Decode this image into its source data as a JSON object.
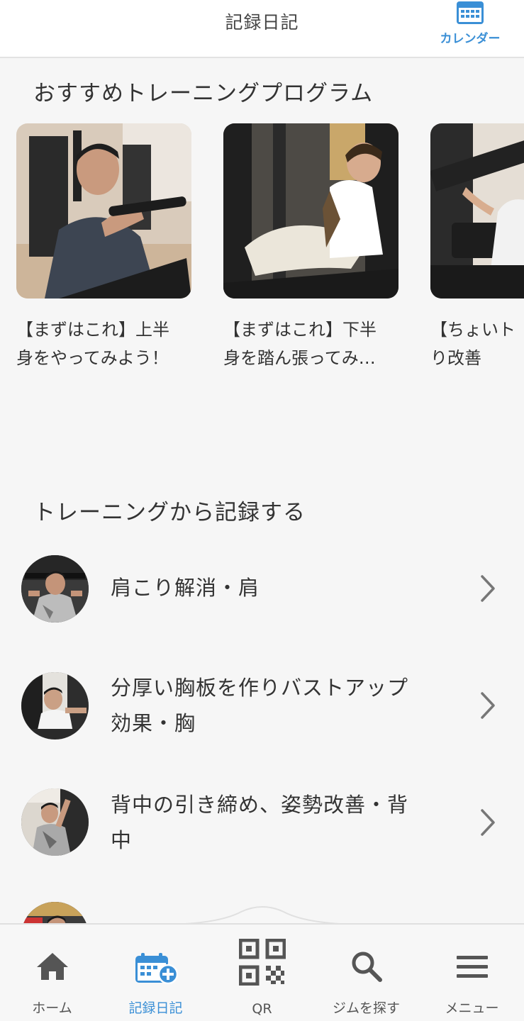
{
  "header": {
    "title": "記録日記",
    "calendar_label": "カレンダー"
  },
  "recommended": {
    "title": "おすすめトレーニングプログラム",
    "cards": [
      {
        "line1": "【まずはこれ】上半",
        "line2": "身をやってみよう！"
      },
      {
        "line1": "【まずはこれ】下半",
        "line2": "身を踏ん張ってみ…"
      },
      {
        "line1": "【ちょいト",
        "line2": "り改善"
      }
    ]
  },
  "record": {
    "title": "トレーニングから記録する",
    "items": [
      {
        "line1": "肩こり解消・肩",
        "line2": ""
      },
      {
        "line1": "分厚い胸板を作りバストアップ",
        "line2": "効果・胸"
      },
      {
        "line1": "背中の引き締め、姿勢改善・背",
        "line2": "中"
      }
    ]
  },
  "tabbar": {
    "home": "ホーム",
    "diary": "記録日記",
    "qr": "QR",
    "gym": "ジムを探す",
    "menu": "メニュー"
  },
  "colors": {
    "accent": "#3a8fd6",
    "icon_gray": "#555555",
    "background": "#f6f6f6"
  }
}
